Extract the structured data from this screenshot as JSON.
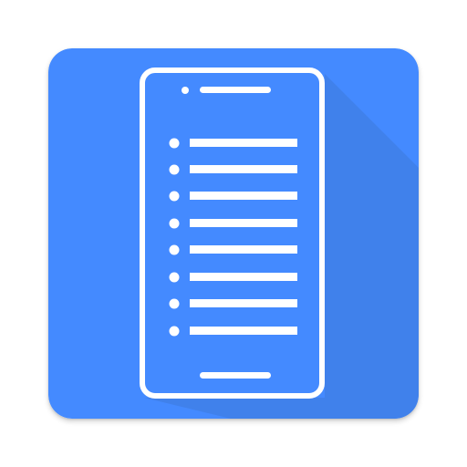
{
  "icon": {
    "name": "phone-list-app-icon",
    "background_color": "#448AFF",
    "shadow_color": "#3F7FE8",
    "foreground_color": "#FFFFFF",
    "list_items_count_visible": 8
  }
}
